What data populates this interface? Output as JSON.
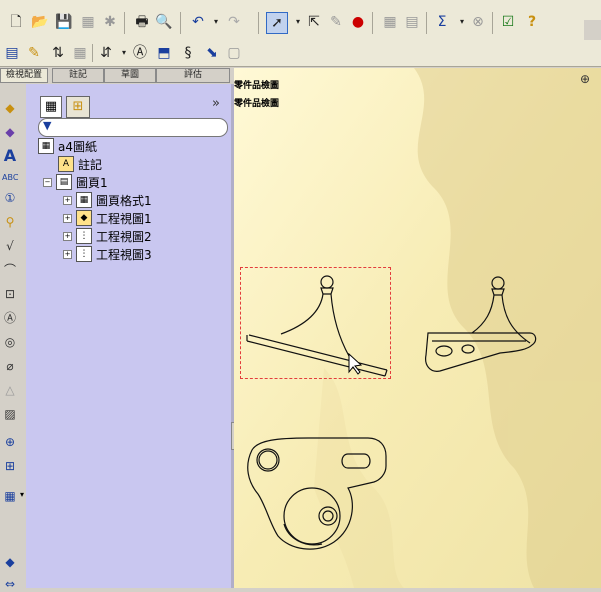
{
  "left_tabs": [
    "檢視配置",
    "註記",
    "草圖",
    "評估"
  ],
  "tree": {
    "root": "a4圖紙",
    "notes": "註記",
    "sheet": "圖頁1",
    "children": [
      "圖頁格式1",
      "工程視圖1",
      "工程視圖2",
      "工程視圖3"
    ]
  },
  "filter": {
    "value": "",
    "placeholder": ""
  },
  "sheet_texts": [
    "零件品檢圖",
    "零件品檢圖"
  ],
  "icons": {
    "top": [
      "new-icon",
      "open-icon",
      "save-icon",
      "print-icon",
      "print-preview-icon",
      "undo-icon",
      "redo-icon",
      "select-icon",
      "smart-dimension-icon",
      "traffic-light-icon",
      "grid-icon",
      "sum-icon",
      "options-icon",
      "help-icon"
    ]
  },
  "colors": {
    "sheet_bg": "#fbf4c2",
    "panel_bg": "#c9c7f0",
    "selection": "#e33c3c"
  }
}
